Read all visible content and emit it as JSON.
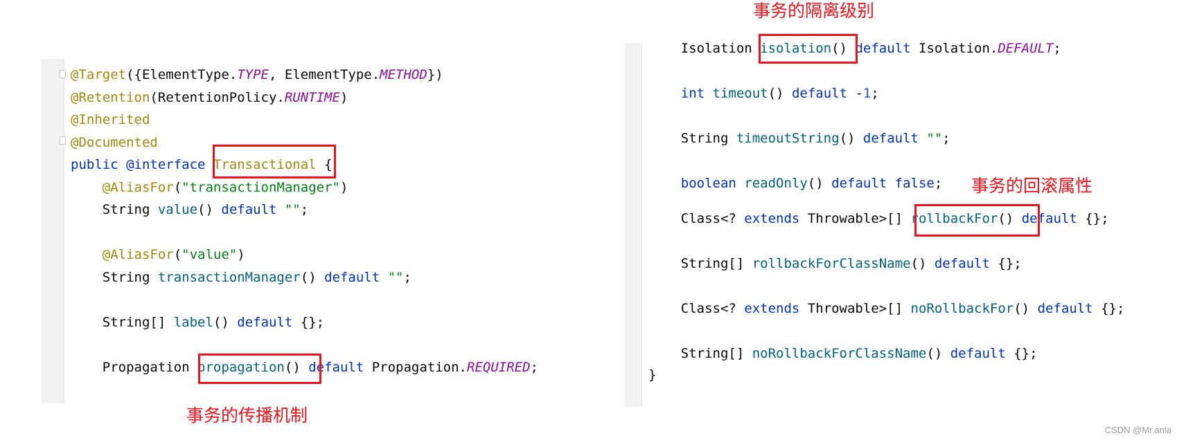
{
  "colors": {
    "keyword": "#0033b3",
    "annotation": "#9e880d",
    "method": "#00627a",
    "string": "#067d17",
    "constant": "#871094",
    "number": "#1750eb",
    "highlight": "#e8141c"
  },
  "left": {
    "lines": [
      {
        "tokens": [
          {
            "t": "@Target",
            "c": "a"
          },
          {
            "t": "({ElementType.",
            "c": "p"
          },
          {
            "t": "TYPE",
            "c": "c"
          },
          {
            "t": ", ElementType.",
            "c": "p"
          },
          {
            "t": "METHOD",
            "c": "c"
          },
          {
            "t": "})",
            "c": "p"
          }
        ]
      },
      {
        "tokens": [
          {
            "t": "@Retention",
            "c": "a"
          },
          {
            "t": "(RetentionPolicy.",
            "c": "p"
          },
          {
            "t": "RUNTIME",
            "c": "c"
          },
          {
            "t": ")",
            "c": "p"
          }
        ]
      },
      {
        "tokens": [
          {
            "t": "@Inherited",
            "c": "a"
          }
        ]
      },
      {
        "tokens": [
          {
            "t": "@Documented",
            "c": "a"
          }
        ]
      },
      {
        "tokens": [
          {
            "t": "public @interface ",
            "c": "k"
          },
          {
            "t": "Transactional",
            "c": "a"
          },
          {
            "t": " {",
            "c": "p"
          }
        ]
      },
      {
        "tokens": [
          {
            "t": "    ",
            "c": "p"
          },
          {
            "t": "@AliasFor",
            "c": "a"
          },
          {
            "t": "(",
            "c": "p"
          },
          {
            "t": "\"transactionManager\"",
            "c": "s"
          },
          {
            "t": ")",
            "c": "p"
          }
        ]
      },
      {
        "tokens": [
          {
            "t": "    String ",
            "c": "p"
          },
          {
            "t": "value",
            "c": "m"
          },
          {
            "t": "() ",
            "c": "p"
          },
          {
            "t": "default ",
            "c": "k"
          },
          {
            "t": "\"\"",
            "c": "s"
          },
          {
            "t": ";",
            "c": "p"
          }
        ]
      },
      {
        "tokens": []
      },
      {
        "tokens": [
          {
            "t": "    ",
            "c": "p"
          },
          {
            "t": "@AliasFor",
            "c": "a"
          },
          {
            "t": "(",
            "c": "p"
          },
          {
            "t": "\"value\"",
            "c": "s"
          },
          {
            "t": ")",
            "c": "p"
          }
        ]
      },
      {
        "tokens": [
          {
            "t": "    String ",
            "c": "p"
          },
          {
            "t": "transactionManager",
            "c": "m"
          },
          {
            "t": "() ",
            "c": "p"
          },
          {
            "t": "default ",
            "c": "k"
          },
          {
            "t": "\"\"",
            "c": "s"
          },
          {
            "t": ";",
            "c": "p"
          }
        ]
      },
      {
        "tokens": []
      },
      {
        "tokens": [
          {
            "t": "    String[] ",
            "c": "p"
          },
          {
            "t": "label",
            "c": "m"
          },
          {
            "t": "() ",
            "c": "p"
          },
          {
            "t": "default ",
            "c": "k"
          },
          {
            "t": "{};",
            "c": "p"
          }
        ]
      },
      {
        "tokens": []
      },
      {
        "tokens": [
          {
            "t": "    Propagation ",
            "c": "p"
          },
          {
            "t": "propagation",
            "c": "m"
          },
          {
            "t": "() ",
            "c": "p"
          },
          {
            "t": "default ",
            "c": "k"
          },
          {
            "t": "Propagation.",
            "c": "p"
          },
          {
            "t": "REQUIRED",
            "c": "c"
          },
          {
            "t": ";",
            "c": "p"
          }
        ]
      }
    ],
    "note_propagation": "事务的传播机制"
  },
  "right": {
    "lines": [
      {
        "tokens": [
          {
            "t": "    Isolation ",
            "c": "p"
          },
          {
            "t": "isolation",
            "c": "m"
          },
          {
            "t": "() ",
            "c": "p"
          },
          {
            "t": "default ",
            "c": "k"
          },
          {
            "t": "Isolation.",
            "c": "p"
          },
          {
            "t": "DEFAULT",
            "c": "c"
          },
          {
            "t": ";",
            "c": "p"
          }
        ]
      },
      {
        "tokens": [
          {
            "t": "    ",
            "c": "p"
          },
          {
            "t": "int ",
            "c": "k"
          },
          {
            "t": "timeout",
            "c": "m"
          },
          {
            "t": "() ",
            "c": "p"
          },
          {
            "t": "default ",
            "c": "k"
          },
          {
            "t": "-",
            "c": "p"
          },
          {
            "t": "1",
            "c": "n"
          },
          {
            "t": ";",
            "c": "p"
          }
        ]
      },
      {
        "tokens": [
          {
            "t": "    String ",
            "c": "p"
          },
          {
            "t": "timeoutString",
            "c": "m"
          },
          {
            "t": "() ",
            "c": "p"
          },
          {
            "t": "default ",
            "c": "k"
          },
          {
            "t": "\"\"",
            "c": "s"
          },
          {
            "t": ";",
            "c": "p"
          }
        ]
      },
      {
        "tokens": [
          {
            "t": "    ",
            "c": "p"
          },
          {
            "t": "boolean ",
            "c": "k"
          },
          {
            "t": "readOnly",
            "c": "m"
          },
          {
            "t": "() ",
            "c": "p"
          },
          {
            "t": "default false",
            "c": "k"
          },
          {
            "t": ";",
            "c": "p"
          }
        ]
      },
      {
        "tokens": [
          {
            "t": "    Class<? ",
            "c": "p"
          },
          {
            "t": "extends ",
            "c": "k"
          },
          {
            "t": "Throwable>[] ",
            "c": "p"
          },
          {
            "t": "rollbackFor",
            "c": "m"
          },
          {
            "t": "() ",
            "c": "p"
          },
          {
            "t": "default ",
            "c": "k"
          },
          {
            "t": "{};",
            "c": "p"
          }
        ]
      },
      {
        "tokens": [
          {
            "t": "    String[] ",
            "c": "p"
          },
          {
            "t": "rollbackForClassName",
            "c": "m"
          },
          {
            "t": "() ",
            "c": "p"
          },
          {
            "t": "default ",
            "c": "k"
          },
          {
            "t": "{};",
            "c": "p"
          }
        ]
      },
      {
        "tokens": [
          {
            "t": "    Class<? ",
            "c": "p"
          },
          {
            "t": "extends ",
            "c": "k"
          },
          {
            "t": "Throwable>[] ",
            "c": "p"
          },
          {
            "t": "noRollbackFor",
            "c": "m"
          },
          {
            "t": "() ",
            "c": "p"
          },
          {
            "t": "default ",
            "c": "k"
          },
          {
            "t": "{};",
            "c": "p"
          }
        ]
      },
      {
        "tokens": [
          {
            "t": "    String[] ",
            "c": "p"
          },
          {
            "t": "noRollbackForClassName",
            "c": "m"
          },
          {
            "t": "() ",
            "c": "p"
          },
          {
            "t": "default ",
            "c": "k"
          },
          {
            "t": "{};",
            "c": "p"
          }
        ]
      },
      {
        "tokens": [
          {
            "t": "}",
            "c": "p"
          }
        ]
      }
    ],
    "note_isolation": "事务的隔离级别",
    "note_rollback": "事务的回滚属性"
  },
  "watermark": "CSDN @Mr.anla"
}
